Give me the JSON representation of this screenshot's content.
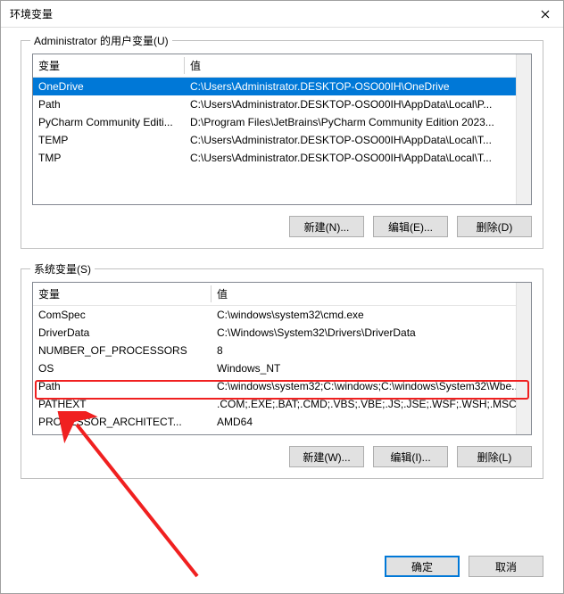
{
  "window": {
    "title": "环境变量"
  },
  "userSection": {
    "legend": "Administrator 的用户变量(U)",
    "columns": {
      "var": "变量",
      "val": "值"
    },
    "rows": [
      {
        "name": "OneDrive",
        "value": "C:\\Users\\Administrator.DESKTOP-OSO00IH\\OneDrive",
        "selected": true
      },
      {
        "name": "Path",
        "value": "C:\\Users\\Administrator.DESKTOP-OSO00IH\\AppData\\Local\\P..."
      },
      {
        "name": "PyCharm Community Editi...",
        "value": "D:\\Program Files\\JetBrains\\PyCharm Community Edition 2023..."
      },
      {
        "name": "TEMP",
        "value": "C:\\Users\\Administrator.DESKTOP-OSO00IH\\AppData\\Local\\T..."
      },
      {
        "name": "TMP",
        "value": "C:\\Users\\Administrator.DESKTOP-OSO00IH\\AppData\\Local\\T..."
      }
    ],
    "buttons": {
      "new": "新建(N)...",
      "edit": "编辑(E)...",
      "delete": "删除(D)"
    }
  },
  "sysSection": {
    "legend": "系统变量(S)",
    "columns": {
      "var": "变量",
      "val": "值"
    },
    "rows": [
      {
        "name": "ComSpec",
        "value": "C:\\windows\\system32\\cmd.exe"
      },
      {
        "name": "DriverData",
        "value": "C:\\Windows\\System32\\Drivers\\DriverData"
      },
      {
        "name": "NUMBER_OF_PROCESSORS",
        "value": "8"
      },
      {
        "name": "OS",
        "value": "Windows_NT"
      },
      {
        "name": "Path",
        "value": "C:\\windows\\system32;C:\\windows;C:\\windows\\System32\\Wbe...",
        "highlight": true
      },
      {
        "name": "PATHEXT",
        "value": ".COM;.EXE;.BAT;.CMD;.VBS;.VBE;.JS;.JSE;.WSF;.WSH;.MSC"
      },
      {
        "name": "PROCESSOR_ARCHITECT...",
        "value": "AMD64"
      }
    ],
    "buttons": {
      "new": "新建(W)...",
      "edit": "编辑(I)...",
      "delete": "删除(L)"
    }
  },
  "footer": {
    "ok": "确定",
    "cancel": "取消"
  }
}
